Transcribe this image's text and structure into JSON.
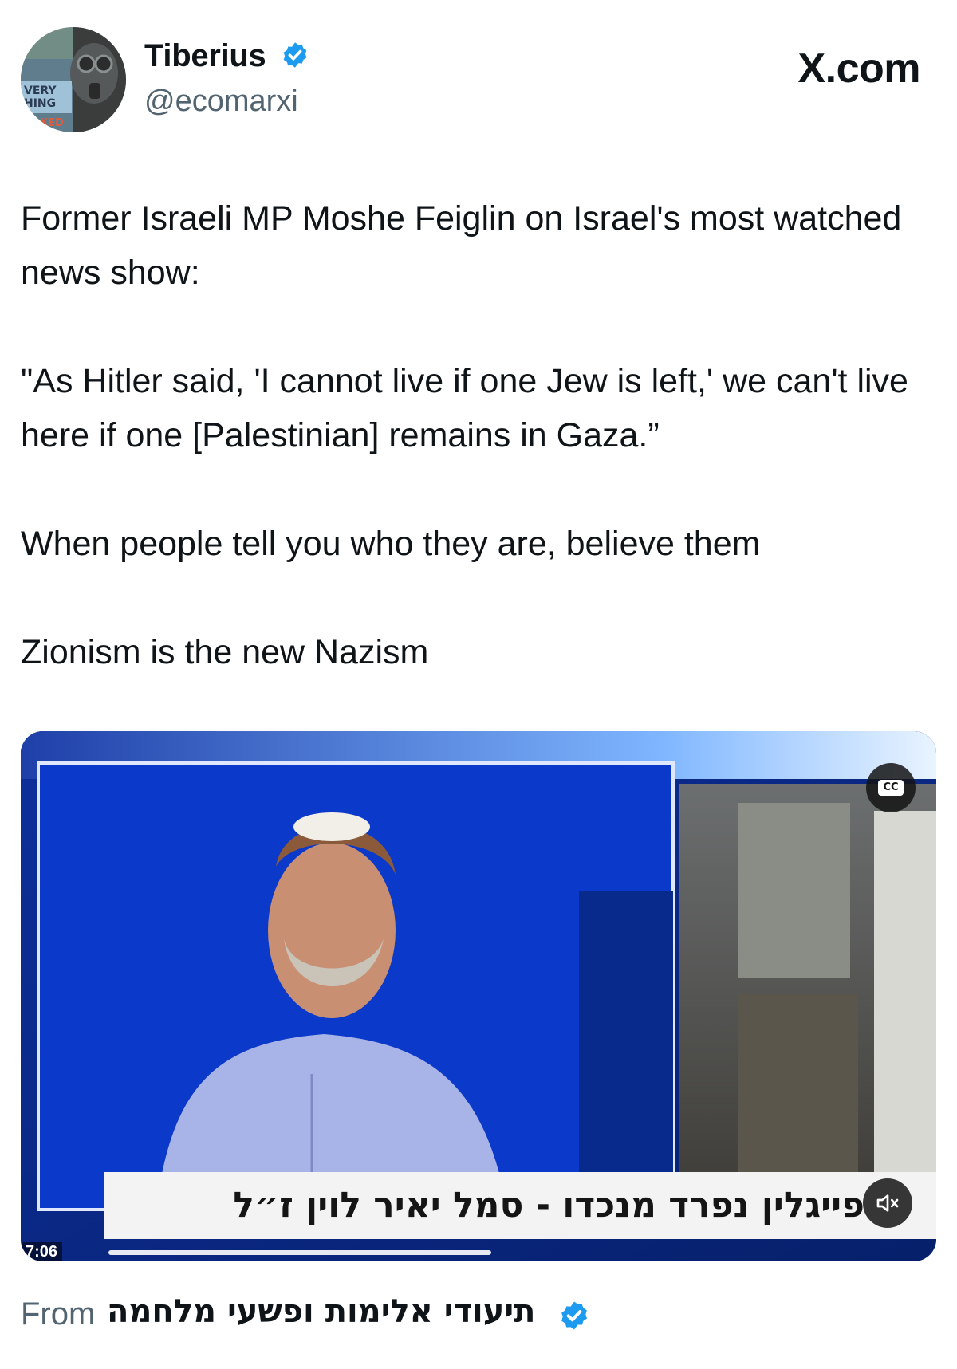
{
  "header": {
    "display_name": "Tiberius",
    "handle": "@ecomarxi",
    "site": "X.com",
    "avatar_text": [
      "VERY",
      "HING",
      "KED"
    ]
  },
  "tweet": {
    "paragraph_1": "Former Israeli MP Moshe Feiglin on Israel's most watched news show:",
    "paragraph_2": "\"As Hitler said, 'I cannot live if one Jew is left,' we can't live here if one [Palestinian] remains in Gaza.”",
    "paragraph_3": "When people tell you who they are, believe them",
    "paragraph_4": "Zionism is the new Nazism"
  },
  "video": {
    "cc_label": "CC",
    "ticker_text": "פייגלין נפרד מנכדו - סמל יאיר לוין ז״ל",
    "timestamp": "7:06",
    "cc_icon": "closed-captions-icon",
    "mute_icon": "speaker-muted-icon"
  },
  "source": {
    "from_label": "From",
    "account_name": "תיעודי אלימות ופשעי מלחמה"
  },
  "colors": {
    "verified_blue": "#1d9bf0",
    "secondary_text": "#536471",
    "studio_blue": "#0b2a86"
  }
}
